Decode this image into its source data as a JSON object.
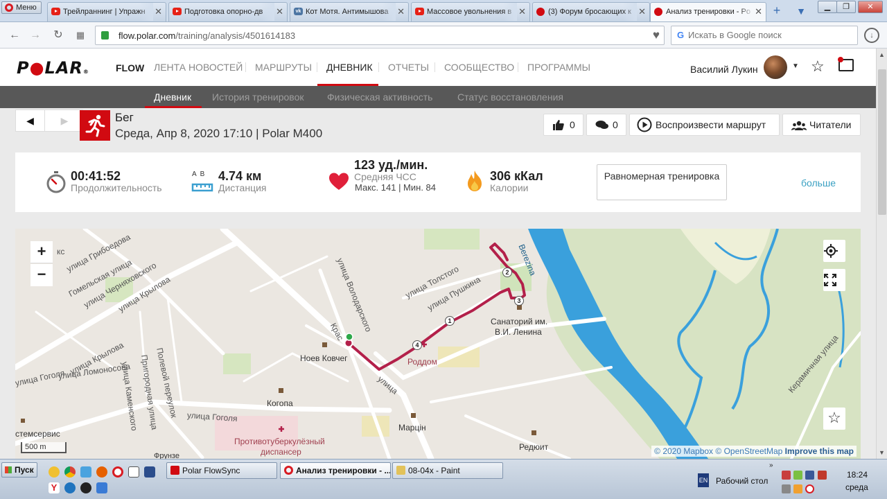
{
  "browser": {
    "menu_label": "Меню",
    "tabs": [
      {
        "label": "Трейлраннинг | Упражн",
        "icon": "youtube-icon"
      },
      {
        "label": "Подготовка опорно-дв",
        "icon": "youtube-icon"
      },
      {
        "label": "Кот Мотя. Антимышова",
        "icon": "vk-icon"
      },
      {
        "label": "Массовое увольнения в",
        "icon": "youtube-icon"
      },
      {
        "label": "(3) Форум бросающих к",
        "icon": "forum-icon"
      },
      {
        "label": "Анализ тренировки - Po",
        "icon": "polar-icon"
      }
    ],
    "url_domain": "flow.polar.com",
    "url_path": "/training/analysis/4501614183",
    "search_placeholder": "Искать в Google поиск"
  },
  "header": {
    "logo": "POLAR",
    "flow_label": "FLOW",
    "nav": [
      {
        "label": "ЛЕНТА НОВОСТЕЙ"
      },
      {
        "label": "МАРШРУТЫ"
      },
      {
        "label": "ДНЕВНИК",
        "active": true
      },
      {
        "label": "ОТЧЕТЫ"
      },
      {
        "label": "СООБЩЕСТВО"
      },
      {
        "label": "ПРОГРАММЫ"
      }
    ],
    "username": "Василий Лукин"
  },
  "subnav": [
    {
      "label": "Дневник",
      "active": true
    },
    {
      "label": "История тренировок"
    },
    {
      "label": "Физическая активность"
    },
    {
      "label": "Статус восстановления"
    }
  ],
  "training": {
    "sport": "Бег",
    "date": "Среда, Апр 8, 2020 17:10",
    "separator": "|",
    "device": "Polar M400",
    "likes": "0",
    "comments": "0",
    "replay_label": "Воспроизвести маршрут",
    "readers_label": "Читатели"
  },
  "summary": {
    "duration_value": "00:41:52",
    "duration_label": "Продолжительность",
    "distance_ab": "A  B",
    "distance_value": "4.74 км",
    "distance_label": "Дистанция",
    "hr_value": "123 уд./мин.",
    "hr_label": "Средняя ЧСС",
    "hr_minmax": "Макс. 141  |  Мин. 84",
    "calories_value": "306 кКал",
    "calories_label": "Калории",
    "workout_type": "Равномерная тренировка",
    "more_link": "больше"
  },
  "map": {
    "streets": [
      "улица Грибоедова",
      "Гомельская улица",
      "улица Черняховского",
      "улица Крылова",
      "Полевой переулок",
      "Пригородная улица",
      "улица Каменского",
      "улица Крылова",
      "улица Ломоносова",
      "улица Гоголя",
      "улица Гоголя",
      "улица Володарского",
      "улица Толстого",
      "улица Пушкина",
      "Крас",
      "улица",
      "Керамичная улица",
      "Berezina",
      "кс"
    ],
    "places": [
      {
        "label": "Ноев Ковчег",
        "style": "normal"
      },
      {
        "label": "Роддом",
        "style": "red"
      },
      {
        "label": "Санаторий им.",
        "style": "normal"
      },
      {
        "label": "В.И. Ленина",
        "style": "normal"
      },
      {
        "label": "Когопа",
        "style": "normal"
      },
      {
        "label": "Марцін",
        "style": "normal"
      },
      {
        "label": "Противотуберкулёзный",
        "style": "red"
      },
      {
        "label": "диспансер",
        "style": "red"
      },
      {
        "label": "Редюит",
        "style": "normal"
      },
      {
        "label": "стемсервис",
        "style": "normal"
      },
      {
        "label": "Фрунзе",
        "style": "normal"
      }
    ],
    "lap_markers": [
      "1",
      "2",
      "3",
      "4"
    ],
    "zoom_in": "+",
    "zoom_out": "−",
    "scale": "500 m",
    "attribution_1": "© 2020 Mapbox",
    "attribution_2": "© OpenStreetMap",
    "attribution_3": "Improve this map"
  },
  "taskbar": {
    "start": "Пуск",
    "tasks": [
      {
        "label": "Polar FlowSync"
      },
      {
        "label": "Анализ тренировки - ...",
        "active": true
      },
      {
        "label": "08-04x - Paint"
      }
    ],
    "lang": "EN",
    "desktop": "Рабочий стол",
    "time": "18:24",
    "day": "среда"
  },
  "colors": {
    "polar_red": "#d10a11",
    "route": "#b3204a",
    "river": "#3aa0dc",
    "link": "#3aa0c2"
  }
}
